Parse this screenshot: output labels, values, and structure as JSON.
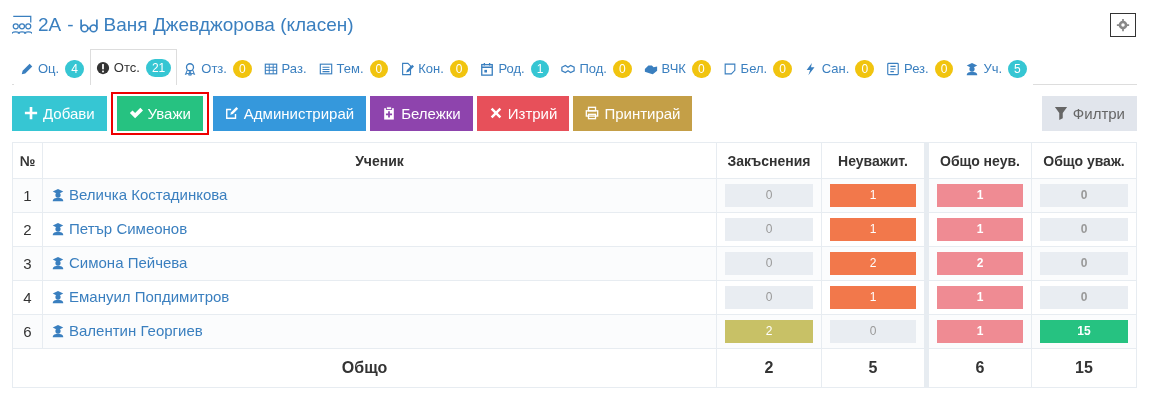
{
  "title": {
    "class": "2А",
    "separator": "-",
    "teacher": "Ваня Джевджорова (класен)"
  },
  "tabs": [
    {
      "label": "Оц.",
      "badge": {
        "text": "4",
        "color": "#36c6d3"
      },
      "selected": false
    },
    {
      "label": "Отс.",
      "badge": {
        "text": "21",
        "color": "#36c6d3"
      },
      "selected": true
    },
    {
      "label": "Отз.",
      "badge": {
        "text": "0",
        "color": "#f1c40f"
      },
      "selected": false
    },
    {
      "label": "Раз.",
      "selected": false
    },
    {
      "label": "Тем.",
      "badge": {
        "text": "0",
        "color": "#f1c40f"
      },
      "selected": false
    },
    {
      "label": "Кон.",
      "badge": {
        "text": "0",
        "color": "#f1c40f"
      },
      "selected": false
    },
    {
      "label": "Род.",
      "badge": {
        "text": "1",
        "color": "#36c6d3"
      },
      "selected": false
    },
    {
      "label": "Под.",
      "badge": {
        "text": "0",
        "color": "#f1c40f"
      },
      "selected": false
    },
    {
      "label": "ВЧК",
      "badge": {
        "text": "0",
        "color": "#f1c40f"
      },
      "selected": false
    },
    {
      "label": "Бел.",
      "badge": {
        "text": "0",
        "color": "#f1c40f"
      },
      "selected": false
    },
    {
      "label": "Сан.",
      "badge": {
        "text": "0",
        "color": "#f1c40f"
      },
      "selected": false
    },
    {
      "label": "Рез.",
      "badge": {
        "text": "0",
        "color": "#f1c40f"
      },
      "selected": false
    },
    {
      "label": "Уч.",
      "badge": {
        "text": "5",
        "color": "#36c6d3"
      },
      "selected": false
    }
  ],
  "buttons": [
    {
      "label": "Добави",
      "color": "#36c6d3",
      "selected": false
    },
    {
      "label": "Уважи",
      "color": "#26c281",
      "selected": true
    },
    {
      "label": "Администрирай",
      "color": "#3598dc",
      "selected": false
    },
    {
      "label": "Бележки",
      "color": "#8e44ad",
      "selected": false
    },
    {
      "label": "Изтрий",
      "color": "#e7505a",
      "selected": false
    },
    {
      "label": "Принтирай",
      "color": "#c49f47",
      "selected": false
    }
  ],
  "filter_button": {
    "label": "Филтри"
  },
  "table": {
    "columns": [
      "№",
      "Ученик",
      "Закъснения",
      "Неуважит.",
      "Общо неув.",
      "Общо уваж."
    ],
    "rows": [
      [
        {
          "text": "1"
        },
        {
          "text": "Величка Костадинкова"
        },
        {
          "text": "0",
          "color": "#e9edf2"
        },
        {
          "text": "1",
          "color": "#f2784b"
        },
        {
          "text": "1",
          "color": "#ef8b93"
        },
        {
          "text": "0",
          "color": "#e9edf2"
        }
      ],
      [
        {
          "text": "2"
        },
        {
          "text": "Петър Симеонов"
        },
        {
          "text": "0",
          "color": "#e9edf2"
        },
        {
          "text": "1",
          "color": "#f2784b"
        },
        {
          "text": "1",
          "color": "#ef8b93"
        },
        {
          "text": "0",
          "color": "#e9edf2"
        }
      ],
      [
        {
          "text": "3"
        },
        {
          "text": "Симона Пейчева"
        },
        {
          "text": "0",
          "color": "#e9edf2"
        },
        {
          "text": "2",
          "color": "#f2784b"
        },
        {
          "text": "2",
          "color": "#ef8b93"
        },
        {
          "text": "0",
          "color": "#e9edf2"
        }
      ],
      [
        {
          "text": "4"
        },
        {
          "text": "Емануил Попдимитров"
        },
        {
          "text": "0",
          "color": "#e9edf2"
        },
        {
          "text": "1",
          "color": "#f2784b"
        },
        {
          "text": "1",
          "color": "#ef8b93"
        },
        {
          "text": "0",
          "color": "#e9edf2"
        }
      ],
      [
        {
          "text": "6"
        },
        {
          "text": "Валентин Георгиев"
        },
        {
          "text": "2",
          "color": "#c8c166"
        },
        {
          "text": "0",
          "color": "#e9edf2"
        },
        {
          "text": "1",
          "color": "#ef8b93"
        },
        {
          "text": "15",
          "color": "#26c281"
        }
      ]
    ],
    "footer": {
      "label": "Общо",
      "totals": [
        "2",
        "5",
        "6",
        "15"
      ]
    }
  }
}
